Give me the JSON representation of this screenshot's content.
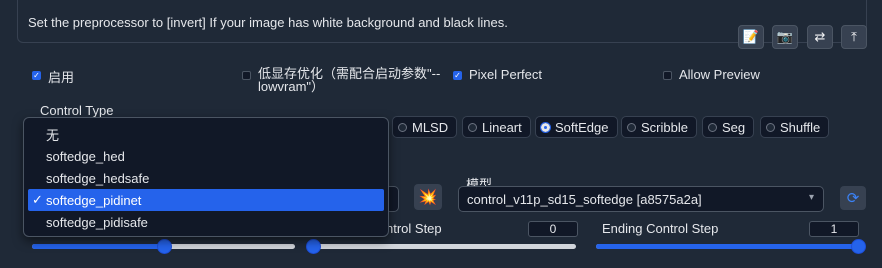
{
  "hint": "Set the preprocessor to [invert] If your image has white background and black lines.",
  "toolbar": [
    {
      "icon": "edit-icon",
      "glyph": "📝"
    },
    {
      "icon": "camera-icon",
      "glyph": "📷"
    },
    {
      "icon": "swap-icon",
      "glyph": "⇄"
    },
    {
      "icon": "upload-icon",
      "glyph": "⤒"
    }
  ],
  "options": {
    "enable": {
      "label": "启用",
      "checked": true
    },
    "lowvram": {
      "label": "低显存优化（需配合启动参数\"--lowvram\"）",
      "checked": false
    },
    "pixel_perfect": {
      "label": "Pixel Perfect",
      "checked": true
    },
    "allow_preview": {
      "label": "Allow Preview",
      "checked": false
    }
  },
  "control_type": {
    "label": "Control Type",
    "visible_options": [
      "MLSD",
      "Lineart",
      "SoftEdge",
      "Scribble",
      "Seg",
      "Shuffle"
    ],
    "selected": "SoftEdge"
  },
  "preprocessor_menu": {
    "items": [
      "无",
      "softedge_hed",
      "softedge_hedsafe",
      "softedge_pidinet",
      "softedge_pidisafe"
    ],
    "selected": "softedge_pidinet",
    "check_mark": "✓"
  },
  "model": {
    "label": "模型",
    "value": "control_v11p_sd15_softedge [a8575a2a]",
    "chevron": "▾",
    "refresh_glyph": "⟳"
  },
  "run_glyph": "💥",
  "steps": {
    "starting": {
      "label_visible": "ntrol Step",
      "value": "0",
      "fraction": 0.0
    },
    "ending": {
      "label": "Ending Control Step",
      "value": "1",
      "fraction": 1.0
    },
    "weight_fraction": 0.5
  },
  "colors": {
    "accent": "#2563eb",
    "background": "#1f2937",
    "field": "#111827"
  }
}
